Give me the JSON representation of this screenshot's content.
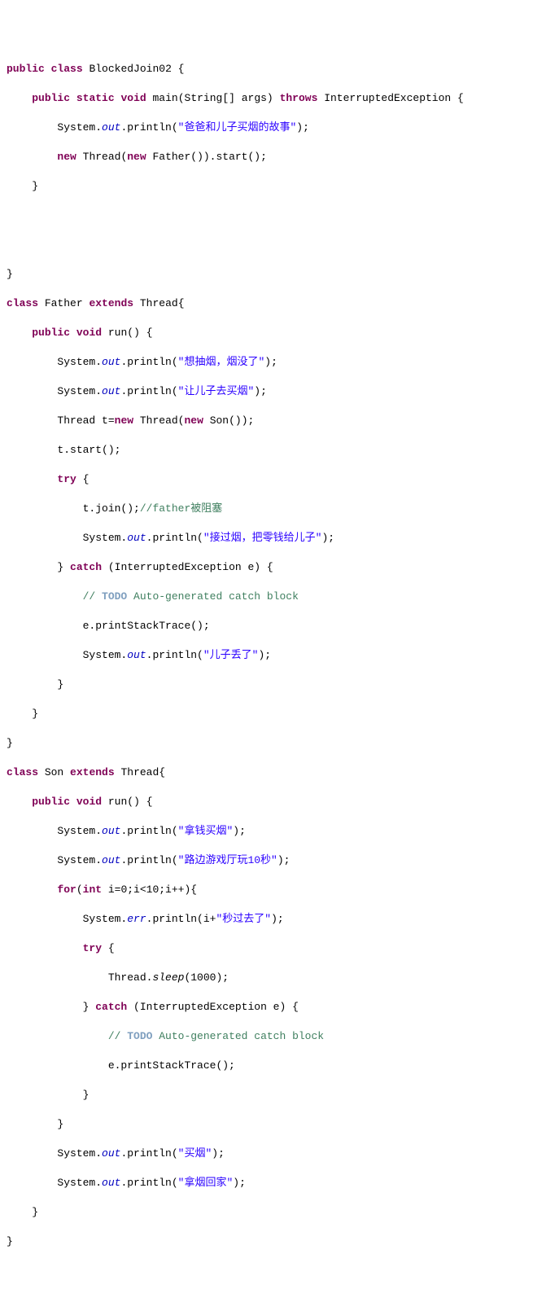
{
  "code": {
    "BlockedJoin02": {
      "decl_public": "public",
      "decl_class": "class",
      "name": "BlockedJoin02",
      "main": {
        "public": "public",
        "static": "static",
        "void": "void",
        "name": "main",
        "param": "(String[] args)",
        "throws_kw": "throws",
        "throws_type": "InterruptedException",
        "print_stmt_prefix": "System.",
        "out": "out",
        "println": ".println(",
        "str1": "\"爸爸和儿子买烟的故事\"",
        "close": ");",
        "new1": "new",
        "thread": "Thread(",
        "new2": "new",
        "father_call": "Father()).start();"
      }
    },
    "Father": {
      "class_kw": "class",
      "name": "Father",
      "extends_kw": "extends",
      "super": "Thread",
      "run": {
        "public": "public",
        "void": "void",
        "name": "run()",
        "sys": "System.",
        "out": "out",
        "println": ".println(",
        "str1": "\"想抽烟，烟没了\"",
        "str2": "\"让儿子去买烟\"",
        "thread_decl": "Thread t=",
        "new1": "new",
        "thread_ctor": "Thread(",
        "new2": "new",
        "son_call": "Son());",
        "start": "t.start();",
        "try_kw": "try",
        "join": "t.join();",
        "cmt1": "//father被阻塞",
        "str3": "\"接过烟，把零钱给儿子\"",
        "catch_kw": "catch",
        "catch_param": "(InterruptedException e)",
        "todo_cmt": "// ",
        "todo": "TODO",
        "todo_rest": " Auto-generated catch block",
        "stack": "e.printStackTrace();",
        "str4": "\"儿子丢了\""
      }
    },
    "Son": {
      "class_kw": "class",
      "name": "Son",
      "extends_kw": "extends",
      "super": "Thread",
      "run": {
        "public": "public",
        "void": "void",
        "name": "run()",
        "sys": "System.",
        "out": "out",
        "err": "err",
        "println": ".println(",
        "str1": "\"拿钱买烟\"",
        "str2": "\"路边游戏厅玩10秒\"",
        "for_kw": "for",
        "for_open": "(",
        "int_kw": "int",
        "for_cond": " i=0;i<10;i++){",
        "print_i": ".println(i+",
        "str3": "\"秒过去了\"",
        "try_kw": "try",
        "thread_sleep": "Thread.",
        "sleep": "sleep",
        "sleep_arg": "(1000);",
        "catch_kw": "catch",
        "catch_param": "(InterruptedException e)",
        "todo_cmt": "// ",
        "todo": "TODO",
        "todo_rest": " Auto-generated catch block",
        "stack": "e.printStackTrace();",
        "str4": "\"买烟\"",
        "str5": "\"拿烟回家\""
      }
    },
    "close_paren": ");",
    "brace_open": "{",
    "brace_close": "}"
  }
}
